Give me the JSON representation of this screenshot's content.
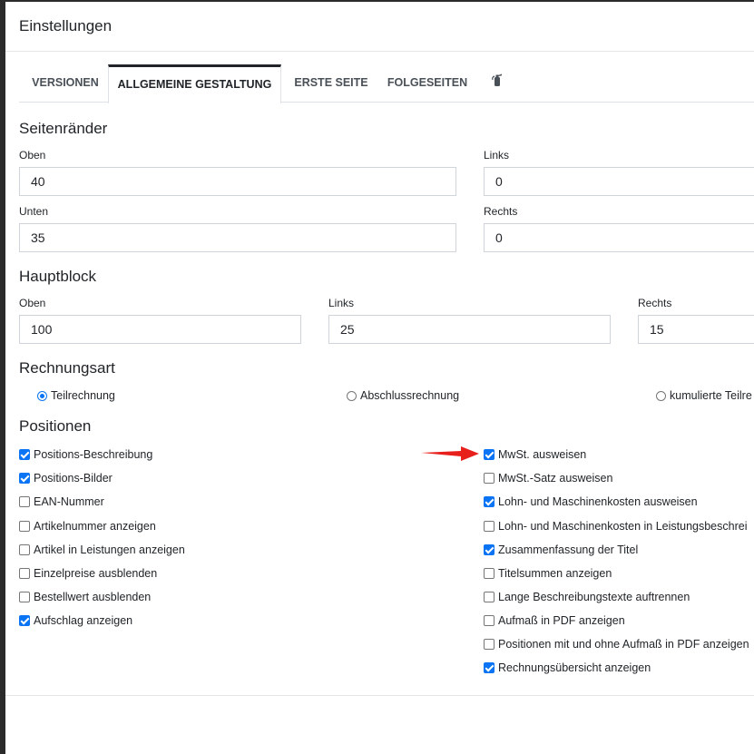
{
  "modal": {
    "title": "Einstellungen"
  },
  "tabs": [
    {
      "label": "VERSIONEN"
    },
    {
      "label": "ALLGEMEINE GESTALTUNG"
    },
    {
      "label": "ERSTE SEITE"
    },
    {
      "label": "FOLGESEITEN"
    }
  ],
  "tab_icon": "fire-extinguisher-icon",
  "seitenraender": {
    "title": "Seitenränder",
    "oben": {
      "label": "Oben",
      "value": "40"
    },
    "links": {
      "label": "Links",
      "value": "0"
    },
    "unten": {
      "label": "Unten",
      "value": "35"
    },
    "rechts": {
      "label": "Rechts",
      "value": "0"
    }
  },
  "hauptblock": {
    "title": "Hauptblock",
    "oben": {
      "label": "Oben",
      "value": "100"
    },
    "links": {
      "label": "Links",
      "value": "25"
    },
    "rechts": {
      "label": "Rechts",
      "value": "15"
    }
  },
  "rechnungsart": {
    "title": "Rechnungsart",
    "options": [
      {
        "label": "Teilrechnung",
        "selected": true
      },
      {
        "label": "Abschlussrechnung",
        "selected": false
      },
      {
        "label": "kumulierte Teilre",
        "selected": false
      }
    ]
  },
  "positionen": {
    "title": "Positionen",
    "left": [
      {
        "label": "Positions-Beschreibung",
        "checked": true
      },
      {
        "label": "Positions-Bilder",
        "checked": true
      },
      {
        "label": "EAN-Nummer",
        "checked": false
      },
      {
        "label": "Artikelnummer anzeigen",
        "checked": false
      },
      {
        "label": "Artikel in Leistungen anzeigen",
        "checked": false
      },
      {
        "label": "Einzelpreise ausblenden",
        "checked": false
      },
      {
        "label": "Bestellwert ausblenden",
        "checked": false
      },
      {
        "label": "Aufschlag anzeigen",
        "checked": true
      }
    ],
    "right": [
      {
        "label": "MwSt. ausweisen",
        "checked": true
      },
      {
        "label": "MwSt.-Satz ausweisen",
        "checked": false
      },
      {
        "label": "Lohn- und Maschinenkosten ausweisen",
        "checked": true
      },
      {
        "label": "Lohn- und Maschinenkosten in Leistungsbeschrei",
        "checked": false
      },
      {
        "label": "Zusammenfassung der Titel",
        "checked": true
      },
      {
        "label": "Titelsummen anzeigen",
        "checked": false
      },
      {
        "label": "Lange Beschreibungstexte auftrennen",
        "checked": false
      },
      {
        "label": "Aufmaß in PDF anzeigen",
        "checked": false
      },
      {
        "label": "Positionen mit und ohne Aufmaß in PDF anzeigen",
        "checked": false
      },
      {
        "label": "Rechnungsübersicht anzeigen",
        "checked": true
      }
    ]
  },
  "colors": {
    "accent": "#0a74f4",
    "annotation_arrow": "#e8201c",
    "backdrop": "#2b2b2b"
  }
}
